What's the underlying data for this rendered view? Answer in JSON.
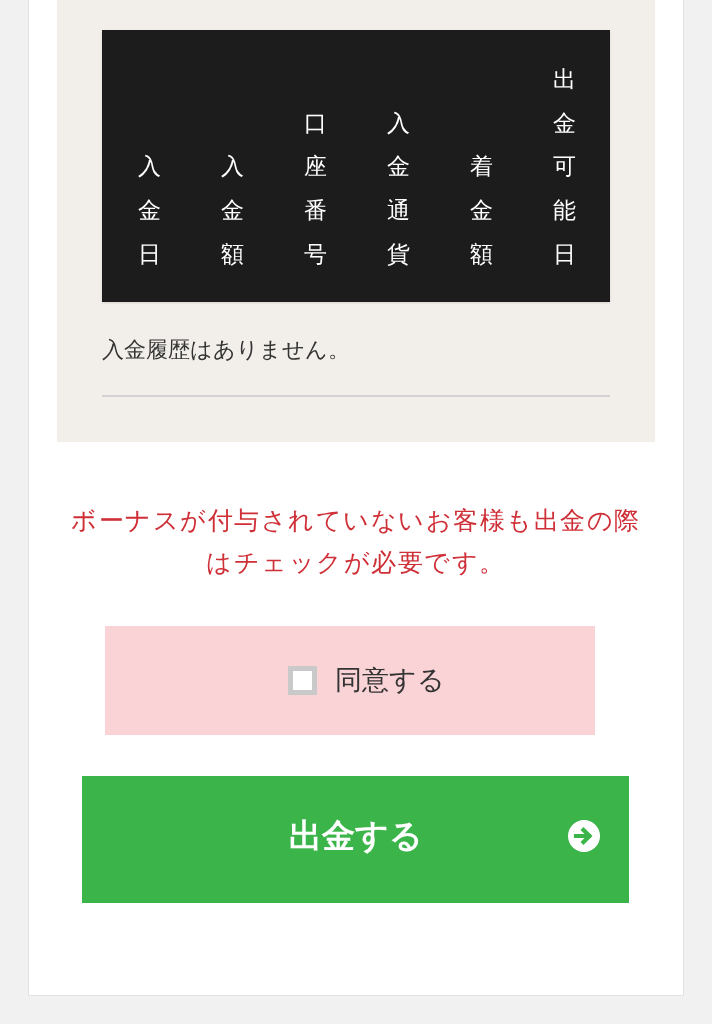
{
  "deposit_history": {
    "columns": [
      "入金日",
      "入金額",
      "口座番号",
      "入金通貨",
      "着金額",
      "出金可能日"
    ],
    "empty_message": "入金履歴はありません。"
  },
  "notice": "ボーナスが付与されていないお客様も出金の際はチェックが必要です。",
  "agree": {
    "label": "同意する",
    "checked": false
  },
  "submit_button": {
    "label": "出金する"
  }
}
